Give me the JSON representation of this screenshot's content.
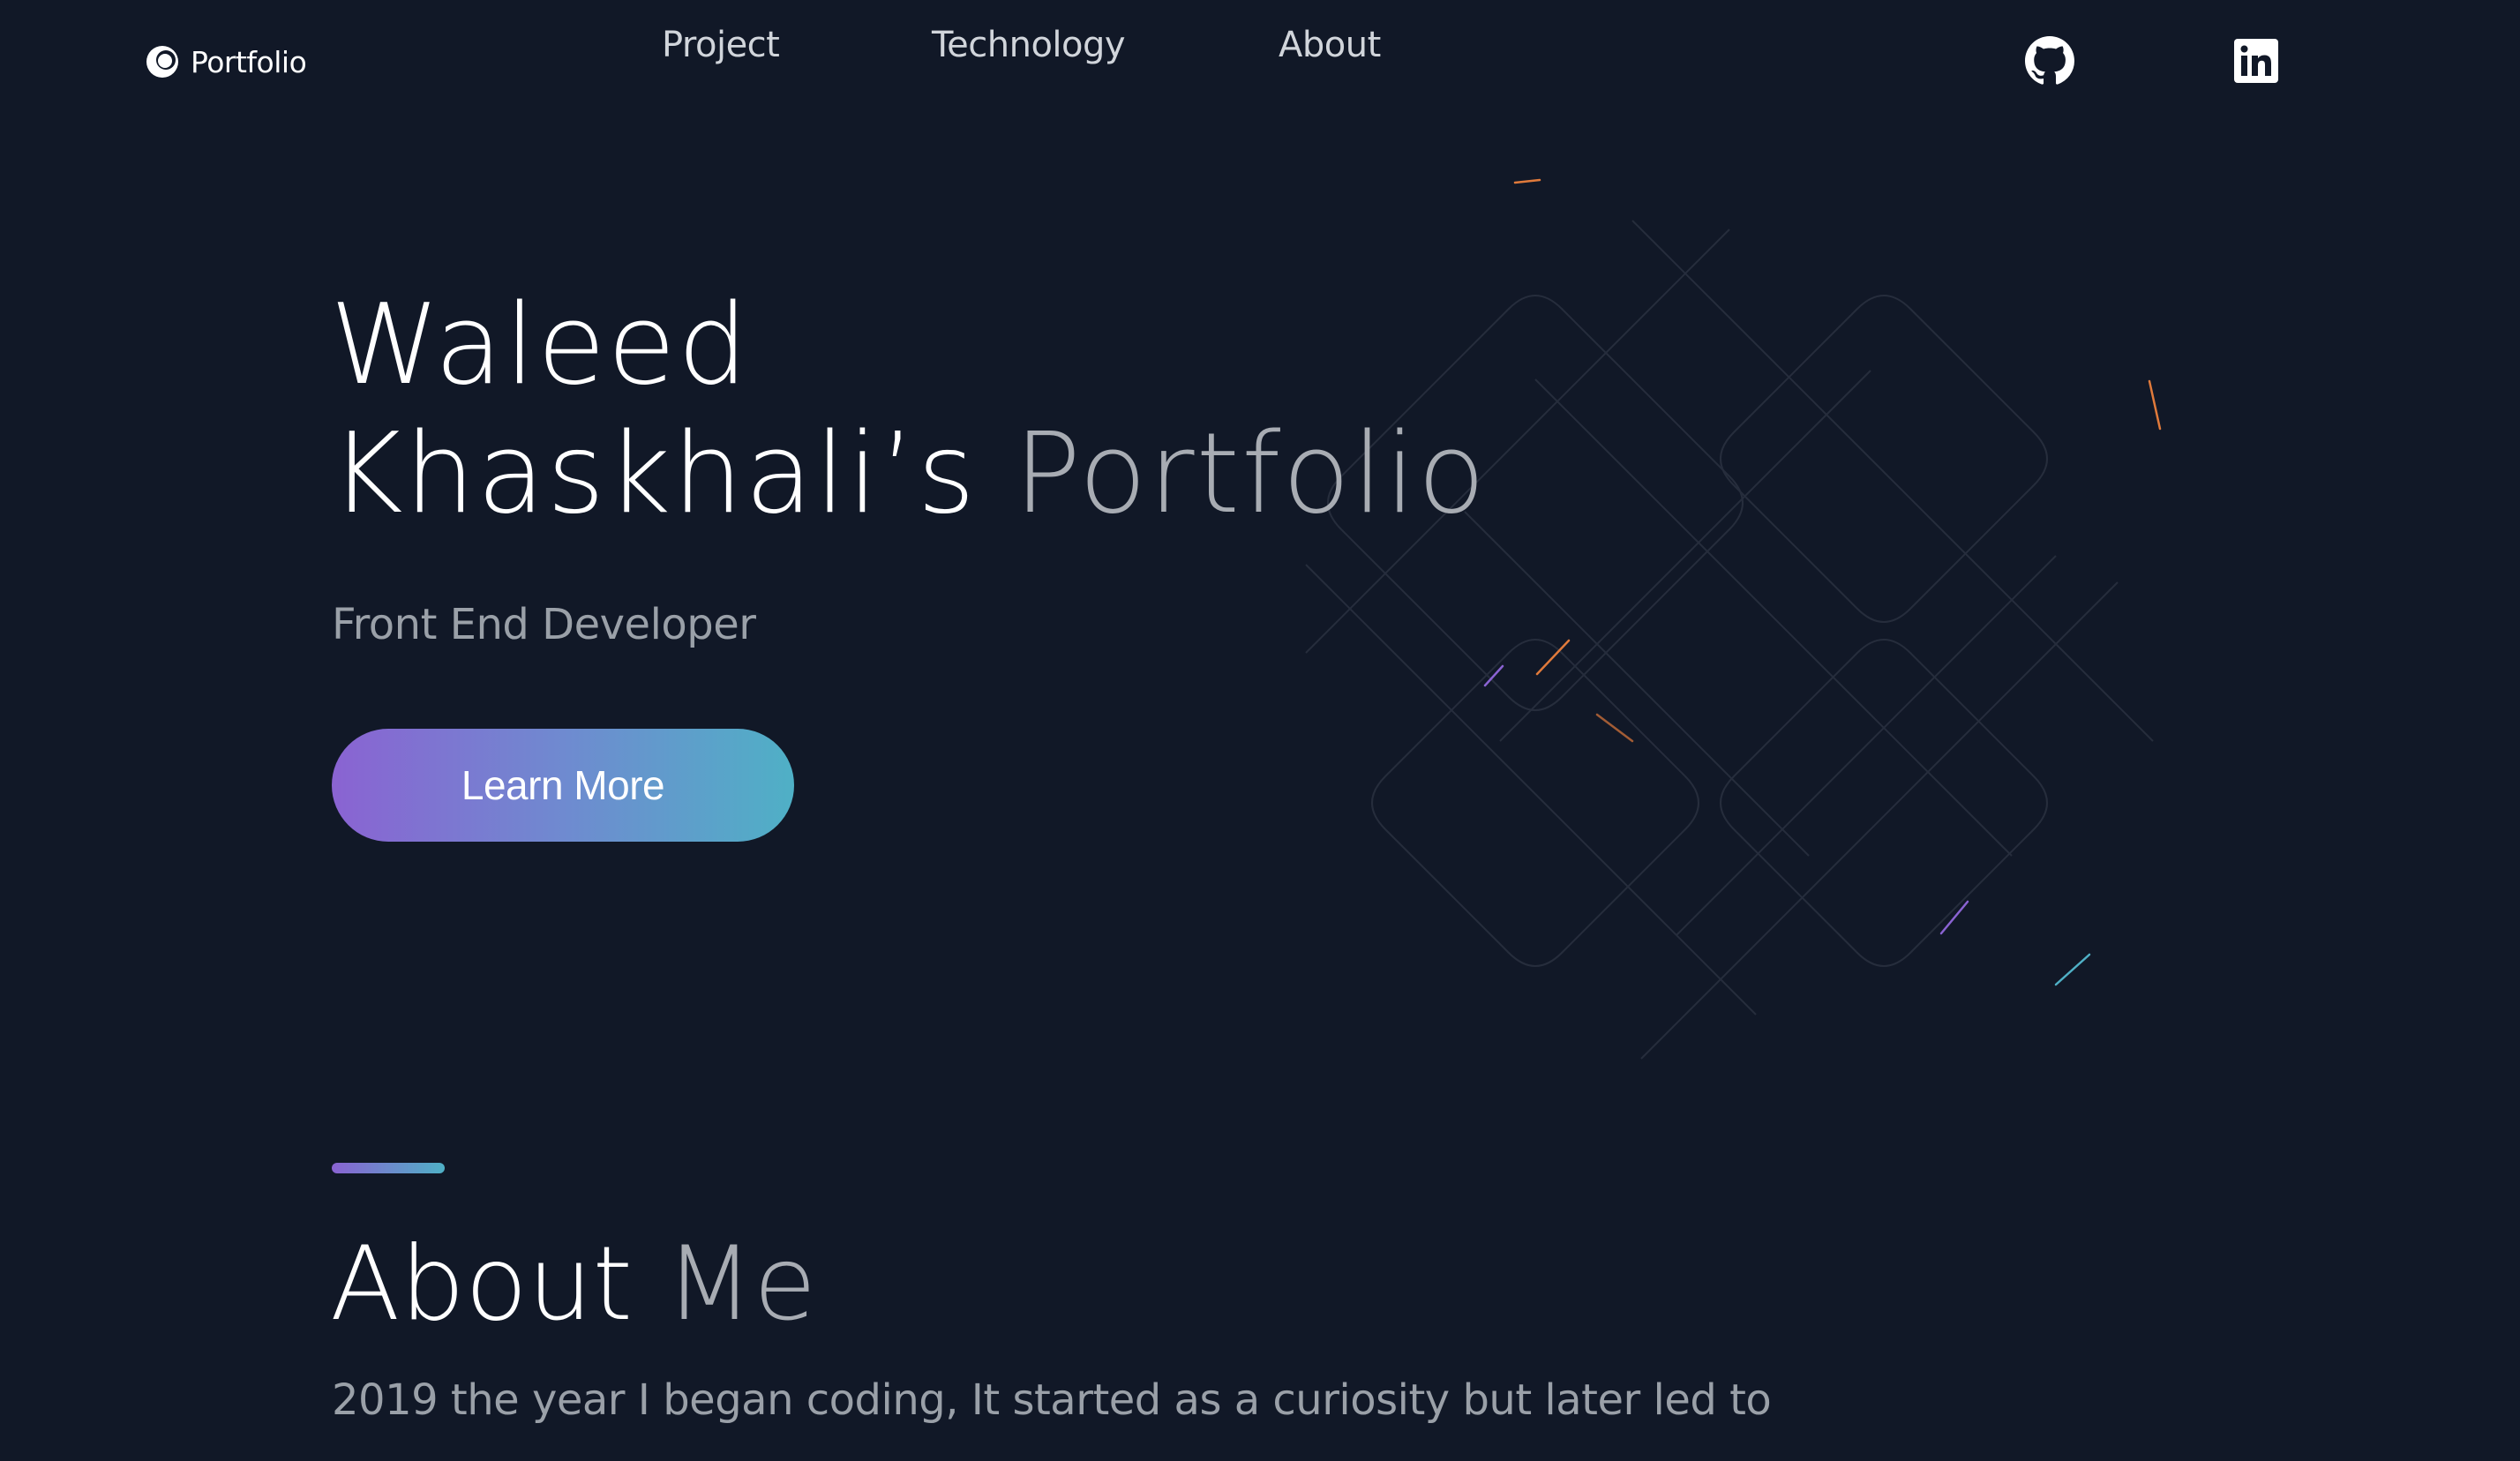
{
  "nav": {
    "logo_text": "Portfolio",
    "links": [
      {
        "label": "Project"
      },
      {
        "label": "Technology"
      },
      {
        "label": "About"
      }
    ],
    "social": [
      {
        "icon": "github-icon"
      },
      {
        "icon": "linkedin-icon"
      }
    ]
  },
  "hero": {
    "title_line1": "Waleed",
    "title_line2_part1": "Khaskhali’s",
    "title_line2_part2": "Portfolio",
    "subtitle": "Front End Developer",
    "cta_label": "Learn More"
  },
  "about": {
    "title_word1": "About",
    "title_word2": "Me",
    "text_line1": "2019 the year I began coding, It started as a curiosity but later led to"
  },
  "colors": {
    "background": "#111827",
    "gradient_start": "#8a63d2",
    "gradient_end": "#4fb0c6",
    "muted_text": "#9aa0a8"
  }
}
